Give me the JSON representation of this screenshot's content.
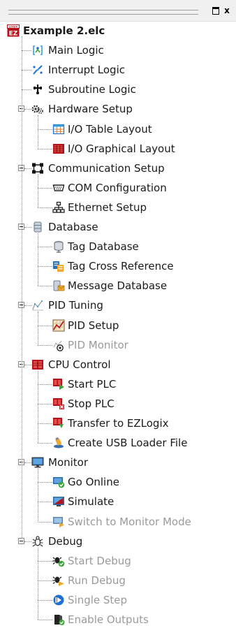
{
  "window": {
    "restore_label": "□",
    "close_label": "x"
  },
  "tree": {
    "root": {
      "label": "Example 2.elc",
      "icon": "ezlogix-project-icon",
      "badge": "EZ",
      "badge_caption": "LOGIX"
    },
    "items": [
      {
        "label": "Main Logic",
        "icon": "main-logic-icon",
        "enabled": true
      },
      {
        "label": "Interrupt Logic",
        "icon": "interrupt-logic-icon",
        "enabled": true
      },
      {
        "label": "Subroutine Logic",
        "icon": "subroutine-logic-icon",
        "enabled": true
      },
      {
        "label": "Hardware Setup",
        "icon": "gears-icon",
        "enabled": true,
        "expanded": true,
        "children": [
          {
            "label": "I/O Table Layout",
            "icon": "table-layout-icon",
            "enabled": true
          },
          {
            "label": "I/O Graphical Layout",
            "icon": "graphical-layout-icon",
            "enabled": true
          }
        ]
      },
      {
        "label": "Communication Setup",
        "icon": "communication-icon",
        "enabled": true,
        "expanded": true,
        "children": [
          {
            "label": "COM Configuration",
            "icon": "serial-port-icon",
            "enabled": true
          },
          {
            "label": "Ethernet Setup",
            "icon": "network-icon",
            "enabled": true
          }
        ]
      },
      {
        "label": "Database",
        "icon": "database-icon",
        "enabled": true,
        "expanded": true,
        "children": [
          {
            "label": "Tag Database",
            "icon": "tag-database-icon",
            "enabled": true
          },
          {
            "label": "Tag Cross Reference",
            "icon": "cross-reference-icon",
            "enabled": true
          },
          {
            "label": "Message Database",
            "icon": "message-database-icon",
            "enabled": true
          }
        ]
      },
      {
        "label": "PID Tuning",
        "icon": "pid-tuning-icon",
        "enabled": true,
        "expanded": true,
        "children": [
          {
            "label": "PID Setup",
            "icon": "pid-setup-icon",
            "enabled": true
          },
          {
            "label": "PID Monitor",
            "icon": "pid-monitor-icon",
            "enabled": false
          }
        ]
      },
      {
        "label": "CPU Control",
        "icon": "cpu-control-icon",
        "enabled": true,
        "expanded": true,
        "children": [
          {
            "label": "Start PLC",
            "icon": "start-plc-icon",
            "enabled": true
          },
          {
            "label": "Stop PLC",
            "icon": "stop-plc-icon",
            "enabled": true
          },
          {
            "label": "Transfer to EZLogix",
            "icon": "transfer-icon",
            "enabled": true
          },
          {
            "label": "Create USB Loader File",
            "icon": "usb-loader-icon",
            "enabled": true
          }
        ]
      },
      {
        "label": "Monitor",
        "icon": "monitor-icon",
        "enabled": true,
        "expanded": true,
        "children": [
          {
            "label": "Go Online",
            "icon": "go-online-icon",
            "enabled": true
          },
          {
            "label": "Simulate",
            "icon": "simulate-icon",
            "enabled": true
          },
          {
            "label": "Switch to Monitor Mode",
            "icon": "monitor-mode-icon",
            "enabled": false
          }
        ]
      },
      {
        "label": "Debug",
        "icon": "bug-icon",
        "enabled": true,
        "expanded": true,
        "children": [
          {
            "label": "Start Debug",
            "icon": "start-debug-icon",
            "enabled": false
          },
          {
            "label": "Run Debug",
            "icon": "run-debug-icon",
            "enabled": false
          },
          {
            "label": "Single Step",
            "icon": "single-step-icon",
            "enabled": false
          },
          {
            "label": "Enable Outputs",
            "icon": "enable-outputs-icon",
            "enabled": false
          }
        ]
      }
    ]
  },
  "colors": {
    "accent_red": "#b5121b",
    "accent_green": "#3aa53a",
    "accent_blue": "#1f6fd1",
    "disabled_text": "#9a9a9a"
  }
}
